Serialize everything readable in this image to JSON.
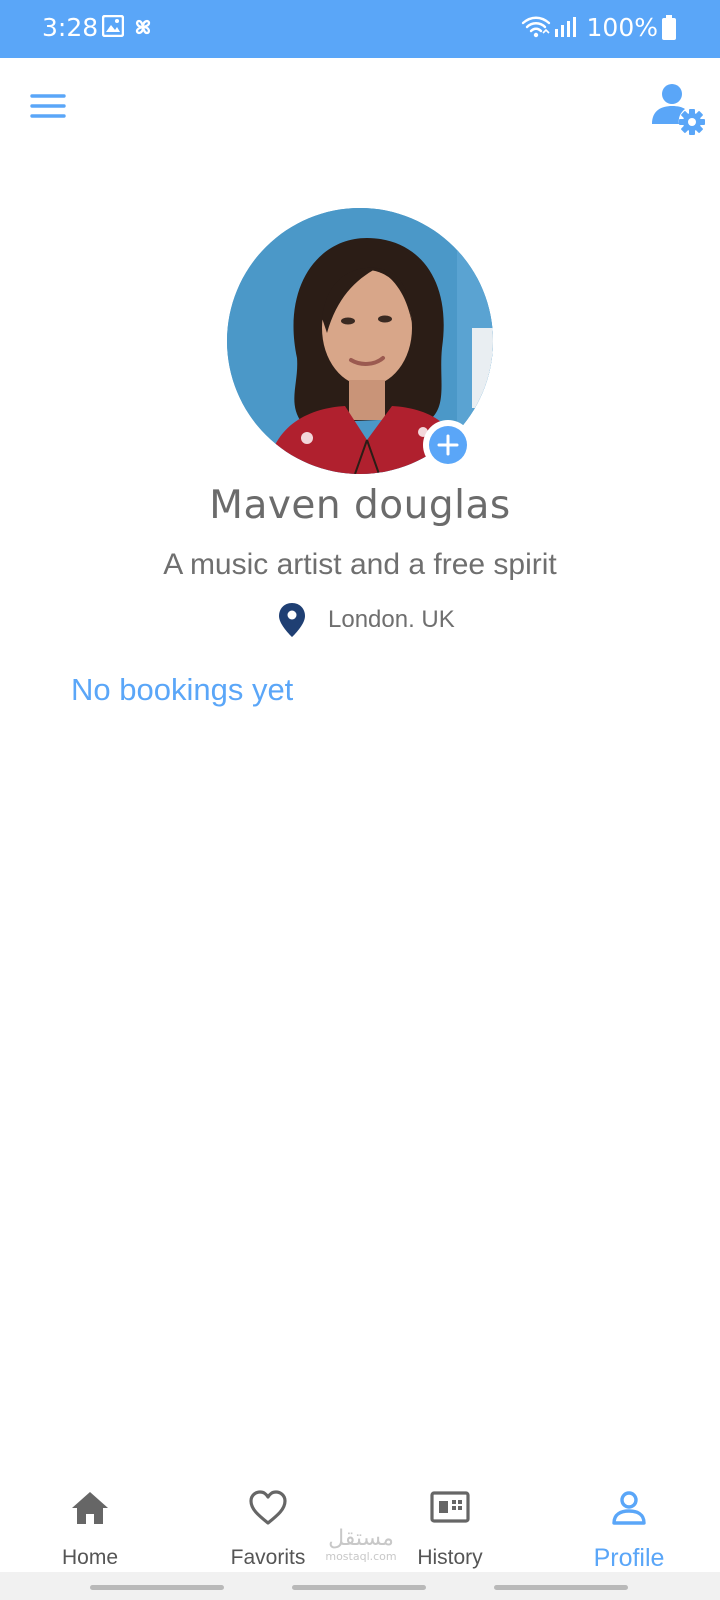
{
  "status_bar": {
    "time": "3:28",
    "battery": "100%",
    "icons": [
      "image-icon",
      "pinwheel-icon",
      "wifi-icon",
      "signal-icon",
      "battery-icon"
    ]
  },
  "top_bar": {
    "menu_icon": "hamburger-menu-icon",
    "settings_icon": "user-settings-icon"
  },
  "profile": {
    "name": "Maven douglas",
    "bio": "A music artist and a free spirit",
    "location": "London. UK",
    "avatar_add_icon": "plus-icon"
  },
  "bookings": {
    "empty_text": "No bookings yet"
  },
  "bottom_nav": {
    "items": [
      {
        "label": "Home",
        "icon": "home-icon"
      },
      {
        "label": "Favorits",
        "icon": "heart-icon"
      },
      {
        "label": "History",
        "icon": "history-icon"
      },
      {
        "label": "Profile",
        "icon": "person-icon"
      }
    ],
    "active_index": 3
  },
  "watermark": {
    "arabic": "مستقل",
    "domain": "mostaql.com"
  },
  "colors": {
    "accent": "#5aa6f8",
    "status_bar": "#5aa6f8",
    "text_gray": "#6b6b6b",
    "pin": "#1f3f73"
  }
}
